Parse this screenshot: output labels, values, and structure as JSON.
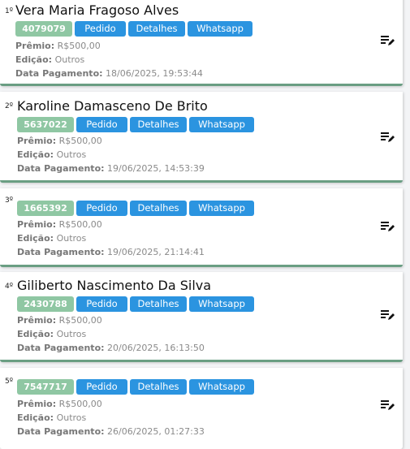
{
  "labels": {
    "premio": "Prêmio:",
    "edicao": "Edição:",
    "data_pagamento": "Data Pagamento:",
    "pedido": "Pedido",
    "detalhes": "Detalhes",
    "whatsapp": "Whatsapp"
  },
  "entries": [
    {
      "rank": "1º",
      "name": "Vera Maria Fragoso Alves",
      "code": "4079079",
      "premio": "R$500,00",
      "edicao": "Outros",
      "data_pagamento": "18/06/2025, 19:53:44"
    },
    {
      "rank": "2º",
      "name": "Karoline Damasceno De Brito",
      "code": "5637022",
      "premio": "R$500,00",
      "edicao": "Outros",
      "data_pagamento": "19/06/2025, 14:53:39"
    },
    {
      "rank": "3º",
      "name": "",
      "code": "1665392",
      "premio": "R$500,00",
      "edicao": "Outros",
      "data_pagamento": "19/06/2025, 21:14:41"
    },
    {
      "rank": "4º",
      "name": "Giliberto Nascimento Da Silva",
      "code": "2430788",
      "premio": "R$500,00",
      "edicao": "Outros",
      "data_pagamento": "20/06/2025, 16:13:50"
    },
    {
      "rank": "5º",
      "name": "",
      "code": "7547717",
      "premio": "R$500,00",
      "edicao": "Outros",
      "data_pagamento": "26/06/2025, 01:27:33"
    }
  ],
  "icons": {
    "menu": "edit-list-icon"
  },
  "colors": {
    "code_badge": "#8fc7a3",
    "button": "#2b94e0",
    "card_border": "#6a9e83"
  }
}
